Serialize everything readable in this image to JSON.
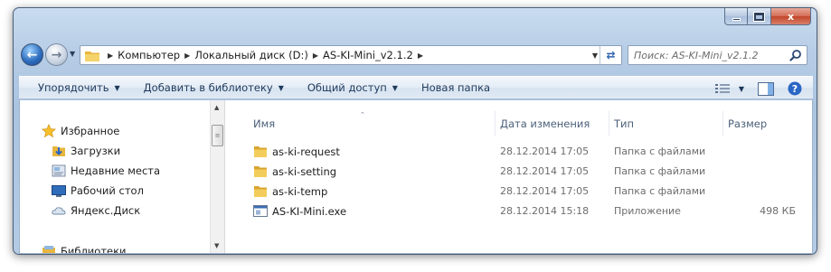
{
  "colors": {
    "frame": "#b7cde6",
    "accent": "#3165b3",
    "folder": "#f0c64a",
    "close": "#c2452a"
  },
  "window": {
    "caption_buttons": [
      "minimize",
      "maximize",
      "close"
    ],
    "close_glyph": "x"
  },
  "nav": {
    "back_icon": "arrow-left-icon",
    "forward_icon": "arrow-right-icon",
    "breadcrumbs": [
      "Компьютер",
      "Локальный диск (D:)",
      "AS-KI-Mini_v2.1.2"
    ],
    "search_placeholder": "Поиск: AS-KI-Mini_v2.1.2"
  },
  "toolbar": {
    "organize": "Упорядочить",
    "add_to_library": "Добавить в библиотеку",
    "share": "Общий доступ",
    "new_folder": "Новая папка"
  },
  "sidebar": {
    "favorites": "Избранное",
    "items": [
      {
        "label": "Загрузки",
        "icon": "downloads-icon"
      },
      {
        "label": "Недавние места",
        "icon": "recent-places-icon"
      },
      {
        "label": "Рабочий стол",
        "icon": "desktop-icon"
      },
      {
        "label": "Яндекс.Диск",
        "icon": "cloud-icon"
      }
    ],
    "libraries": "Библиотеки"
  },
  "columns": {
    "name": "Имя",
    "date": "Дата изменения",
    "type": "Тип",
    "size": "Размер"
  },
  "files": [
    {
      "name": "as-ki-request",
      "date": "28.12.2014 17:05",
      "type": "Папка с файлами",
      "size": "",
      "icon": "folder-icon"
    },
    {
      "name": "as-ki-setting",
      "date": "28.12.2014 17:05",
      "type": "Папка с файлами",
      "size": "",
      "icon": "folder-icon"
    },
    {
      "name": "as-ki-temp",
      "date": "28.12.2014 17:05",
      "type": "Папка с файлами",
      "size": "",
      "icon": "folder-icon"
    },
    {
      "name": "AS-KI-Mini.exe",
      "date": "28.12.2014 15:18",
      "type": "Приложение",
      "size": "498 КБ",
      "icon": "application-icon"
    }
  ]
}
